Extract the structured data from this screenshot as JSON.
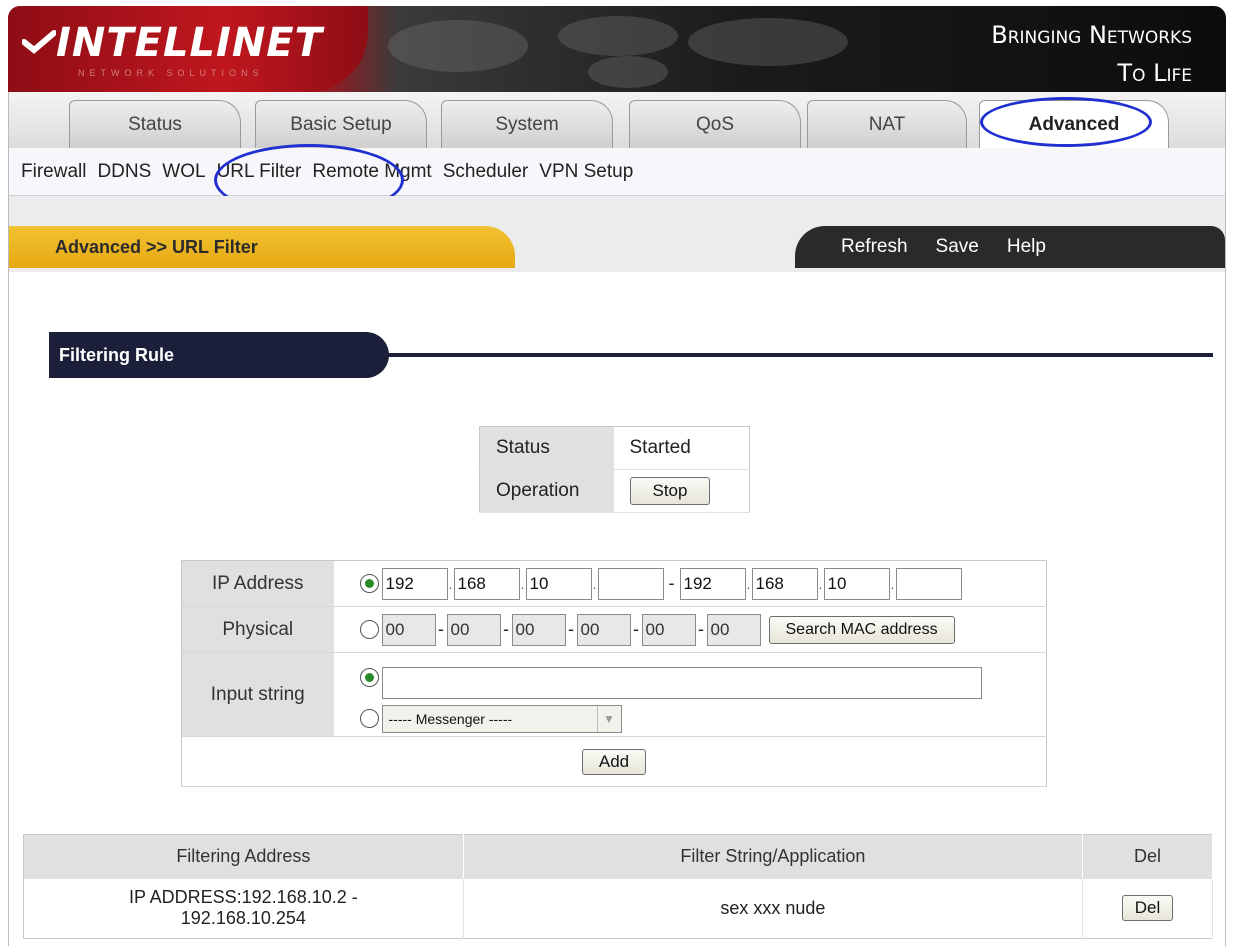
{
  "header": {
    "logo_text": "INTELLINET",
    "logo_sub": "NETWORK SOLUTIONS",
    "tagline_line1": "Bringing Networks",
    "tagline_line2": "To Life"
  },
  "tabs": [
    {
      "label": "Status"
    },
    {
      "label": "Basic Setup"
    },
    {
      "label": "System"
    },
    {
      "label": "QoS"
    },
    {
      "label": "NAT"
    },
    {
      "label": "Advanced",
      "active": true
    }
  ],
  "subnav": [
    "Firewall",
    "DDNS",
    "WOL",
    "URL Filter",
    "Remote Mgmt",
    "Scheduler",
    "VPN Setup"
  ],
  "breadcrumb": "Advanced >> URL Filter",
  "actions": [
    "Refresh",
    "Save",
    "Help"
  ],
  "section_title": "Filtering Rule",
  "status": {
    "status_label": "Status",
    "status_value": "Started",
    "operation_label": "Operation",
    "stop_button": "Stop"
  },
  "rule": {
    "ip_label": "IP Address",
    "ip_from": [
      "192",
      "168",
      "10",
      ""
    ],
    "ip_to": [
      "192",
      "168",
      "10",
      ""
    ],
    "ip_selected": true,
    "physical_label": "Physical",
    "mac": [
      "00",
      "00",
      "00",
      "00",
      "00",
      "00"
    ],
    "search_mac_button": "Search MAC address",
    "input_label": "Input string",
    "input_value": "",
    "app_select": "----- Messenger -----",
    "add_button": "Add"
  },
  "list": {
    "headers": [
      "Filtering Address",
      "Filter String/Application",
      "Del"
    ],
    "rows": [
      {
        "address_line1": "IP ADDRESS:192.168.10.2 -",
        "address_line2": "192.168.10.254",
        "string": "sex xxx nude",
        "del": "Del"
      }
    ]
  },
  "colors": {
    "brand_red": "#c0171e",
    "header_dark": "#1b1b1b",
    "crumb_gold": "#f1c232",
    "section_navy": "#1b1f3a",
    "annotation_blue": "#1f2fd0"
  }
}
